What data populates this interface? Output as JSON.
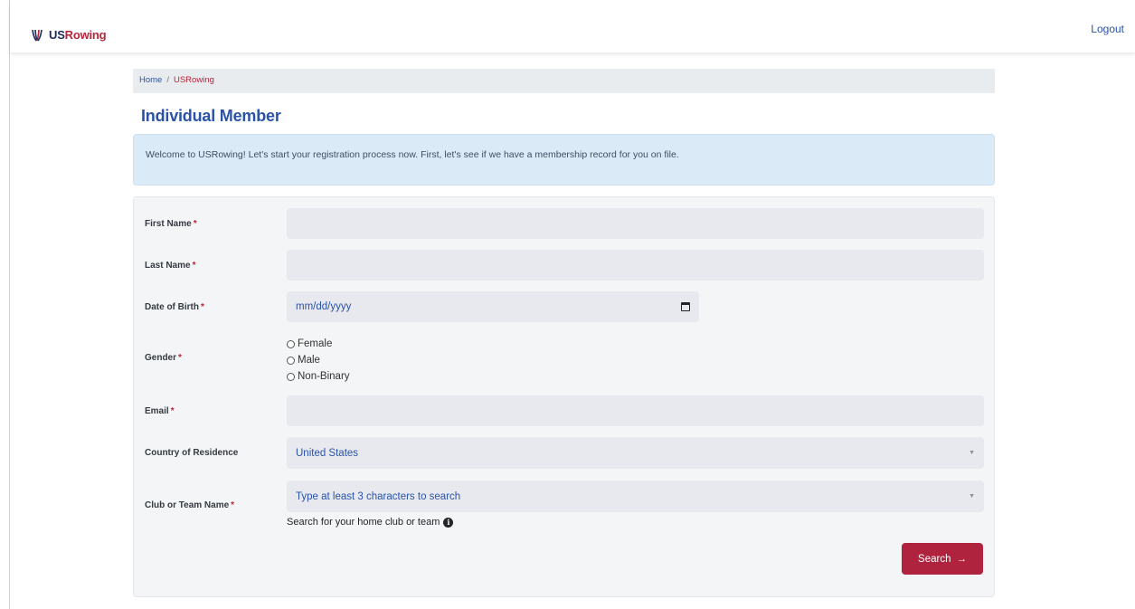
{
  "header": {
    "brand_us": "US",
    "brand_rowing": "Rowing",
    "logout_label": "Logout"
  },
  "breadcrumb": {
    "home": "Home",
    "separator": "/",
    "current": "USRowing"
  },
  "page": {
    "title": "Individual Member",
    "alert": "Welcome to USRowing! Let's start your registration process now. First, let's see if we have a membership record for you on file."
  },
  "form": {
    "required_marker": "*",
    "first_name": {
      "label": "First Name",
      "value": ""
    },
    "last_name": {
      "label": "Last Name",
      "value": ""
    },
    "dob": {
      "label": "Date of Birth",
      "placeholder": "mm/dd/yyyy",
      "icon": "calendar-icon"
    },
    "gender": {
      "label": "Gender",
      "options": [
        "Female",
        "Male",
        "Non-Binary"
      ]
    },
    "email": {
      "label": "Email",
      "value": ""
    },
    "country": {
      "label": "Country of Residence",
      "selected": "United States"
    },
    "club": {
      "label": "Club or Team Name",
      "placeholder": "Type at least 3 characters to search",
      "helper": "Search for your home club or team",
      "helper_icon": "info-icon"
    },
    "search_button": {
      "label": "Search",
      "arrow": "→"
    }
  },
  "colors": {
    "brand_blue": "#2a53a8",
    "brand_red": "#b8243a",
    "button_red": "#b0233e",
    "alert_bg": "#dbeaf7",
    "card_bg": "#f4f5f7",
    "input_bg": "#e8e9ef"
  }
}
